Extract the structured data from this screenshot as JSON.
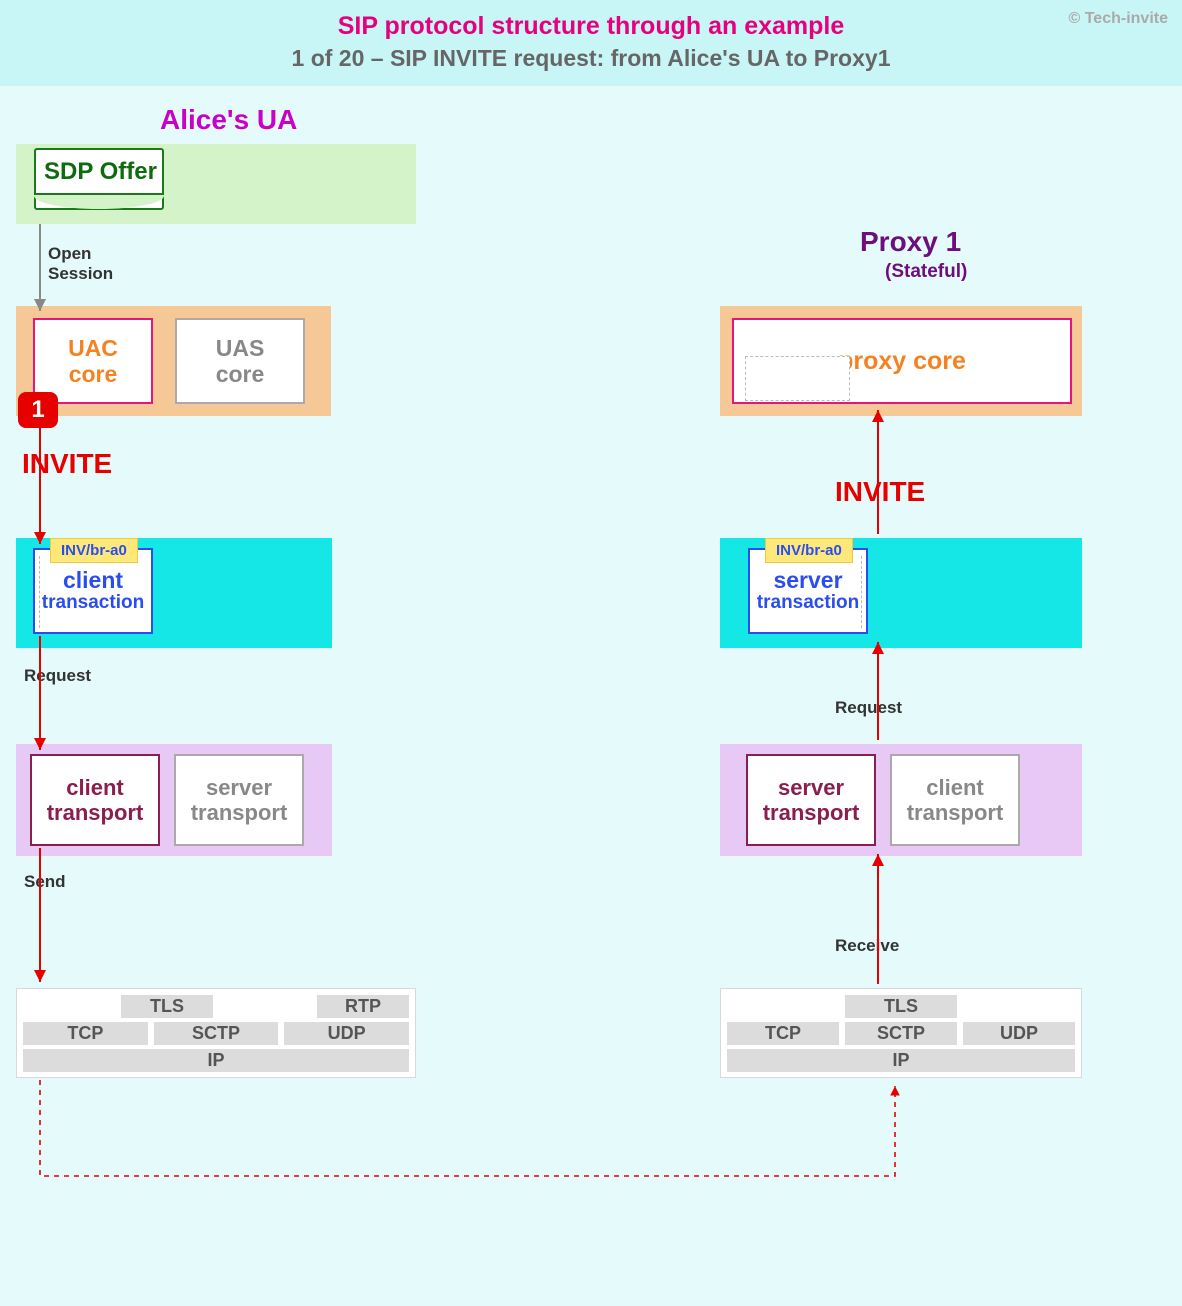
{
  "header": {
    "title": "SIP protocol structure through an example",
    "subtitle": "1 of 20 – SIP INVITE request: from Alice's UA to Proxy1",
    "copyright": "© Tech-invite"
  },
  "alice": {
    "title": "Alice's UA",
    "sdp_offer": "SDP Offer",
    "open_session": "Open\nSession",
    "uac_core_l1": "UAC",
    "uac_core_l2": "core",
    "uas_core_l1": "UAS",
    "uas_core_l2": "core",
    "step": "1",
    "invite": "INVITE",
    "txn_tag": "INV/br-a0",
    "txn_l1": "client",
    "txn_l2": "transaction",
    "request_label": "Request",
    "tp_client_l1": "client",
    "tp_client_l2": "transport",
    "tp_server_l1": "server",
    "tp_server_l2": "transport",
    "send_label": "Send",
    "stack": {
      "tls": "TLS",
      "rtp": "RTP",
      "tcp": "TCP",
      "sctp": "SCTP",
      "udp": "UDP",
      "ip": "IP"
    }
  },
  "proxy": {
    "title": "Proxy 1",
    "subtitle": "(Stateful)",
    "core_label": "proxy core",
    "invite": "INVITE",
    "txn_tag": "INV/br-a0",
    "txn_l1": "server",
    "txn_l2": "transaction",
    "request_label": "Request",
    "tp_server_l1": "server",
    "tp_server_l2": "transport",
    "tp_client_l1": "client",
    "tp_client_l2": "transport",
    "receive_label": "Receive",
    "stack": {
      "tls": "TLS",
      "tcp": "TCP",
      "sctp": "SCTP",
      "udp": "UDP",
      "ip": "IP"
    }
  }
}
